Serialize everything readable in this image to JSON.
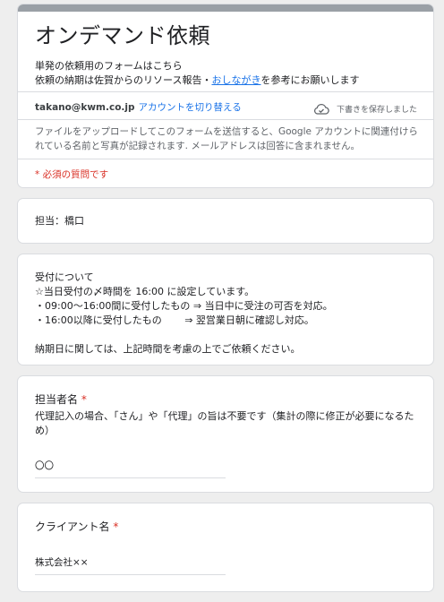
{
  "header": {
    "title": "オンデマンド依頼",
    "desc_line1": "単発の依頼用のフォームはこちら",
    "desc_line2_prefix": "依頼の納期は佐賀からのリソース報告・",
    "desc_link": "おしながき",
    "desc_line2_suffix": "を参考にお願いします",
    "account_email": "takano@kwm.co.jp",
    "switch_account": "アカウントを切り替える",
    "draft_saved": "下書きを保存しました",
    "notice": "ファイルをアップロードしてこのフォームを送信すると、Google アカウントに関連付けられている名前と写真が記録されます. メールアドレスは回答に含まれません。",
    "required_note": "* 必須の質問です"
  },
  "assignee_section": {
    "text": "担当：橋口"
  },
  "reception_section": {
    "text": "受付について\n☆当日受付の〆時間を 16:00 に設定しています。\n・09:00～16:00間に受付したもの ⇒ 当日中に受注の可否を対応。\n・16:00以降に受付したもの　　 ⇒ 翌営業日朝に確認し対応。\n\n納期日に関しては、上記時間を考慮の上でご依頼ください。"
  },
  "question_person": {
    "label": "担当者名",
    "required_mark": "*",
    "help": "代理記入の場合、「さん」や「代理」の旨は不要です（集計の際に修正が必要になるため）",
    "value": "〇〇"
  },
  "question_client": {
    "label": "クライアント名",
    "required_mark": "*",
    "value": "株式会社××"
  }
}
